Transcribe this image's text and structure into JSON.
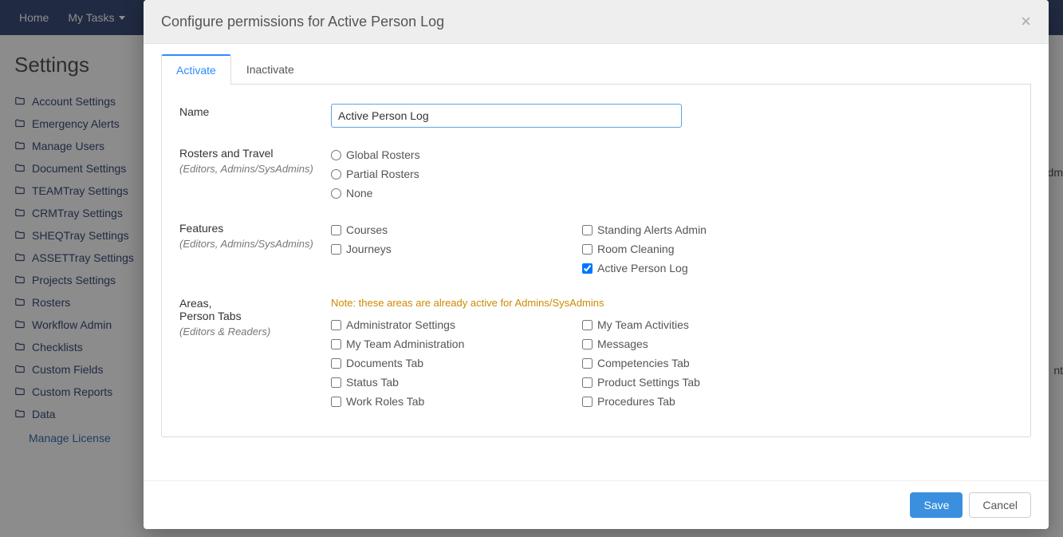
{
  "topbar": {
    "home": "Home",
    "my_tasks": "My Tasks",
    "my_t_partial": "My T"
  },
  "page_title": "Settings",
  "sidebar": {
    "items": [
      "Account Settings",
      "Emergency Alerts",
      "Manage Users",
      "Document Settings",
      "TEAMTray Settings",
      "CRMTray Settings",
      "SHEQTray Settings",
      "ASSETTray Settings",
      "Projects Settings",
      "Rosters",
      "Workflow Admin",
      "Checklists",
      "Custom Fields",
      "Custom Reports",
      "Data"
    ],
    "sub": "Manage License"
  },
  "modal": {
    "title": "Configure permissions for Active Person Log",
    "tabs": {
      "activate": "Activate",
      "inactivate": "Inactivate"
    },
    "name_label": "Name",
    "name_value": "Active Person Log",
    "rosters_label": "Rosters and Travel",
    "rosters_sub": "(Editors, Admins/SysAdmins)",
    "rosters_options": {
      "global": "Global Rosters",
      "partial": "Partial Rosters",
      "none": "None"
    },
    "features_label": "Features",
    "features_sub": "(Editors, Admins/SysAdmins)",
    "features_left": {
      "courses": "Courses",
      "journeys": "Journeys"
    },
    "features_right": {
      "standing_alerts": "Standing Alerts Admin",
      "room_cleaning": "Room Cleaning",
      "active_person_log": "Active Person Log"
    },
    "areas_label1": "Areas,",
    "areas_label2": "Person Tabs",
    "areas_sub": "(Editors & Readers)",
    "areas_note": "Note: these areas are already active for Admins/SysAdmins",
    "areas_left": {
      "admin_settings": "Administrator Settings",
      "my_team_admin": "My Team Administration",
      "documents_tab": "Documents Tab",
      "status_tab": "Status Tab",
      "work_roles_tab": "Work Roles Tab"
    },
    "areas_right": {
      "my_team_activities": "My Team Activities",
      "messages": "Messages",
      "competencies_tab": "Competencies Tab",
      "product_settings_tab": "Product Settings Tab",
      "procedures_tab": "Procedures Tab"
    },
    "buttons": {
      "save": "Save",
      "cancel": "Cancel"
    }
  },
  "bg_fragments": {
    "a": "dm",
    "b": "nt"
  }
}
